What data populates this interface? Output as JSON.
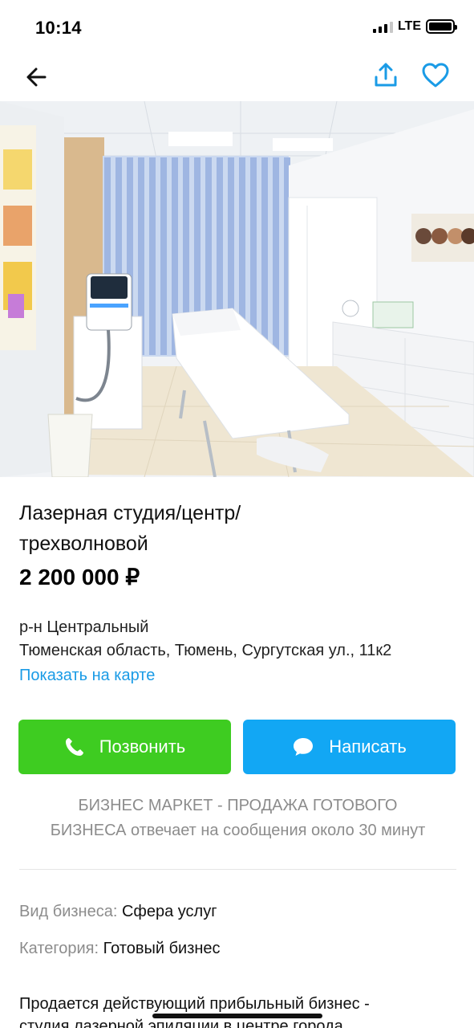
{
  "status_bar": {
    "time": "10:14",
    "network": "LTE"
  },
  "nav": {
    "back": "arrow-left-icon",
    "share": "share-icon",
    "favorite": "heart-icon"
  },
  "listing": {
    "title_line1": "Лазерная студия/центр/",
    "title_line2": "трехволновой",
    "price": "2 200 000 ₽",
    "district": "р-н Центральный",
    "address": "Тюменская область, Тюмень, Сургутская ул., 11к2",
    "map_link": "Показать на карте"
  },
  "actions": {
    "call_label": "Позвонить",
    "write_label": "Написать"
  },
  "seller": {
    "line1": "БИЗНЕС МАРКЕТ - ПРОДАЖА ГОТОВОГО",
    "line2": "БИЗНЕСА отвечает на сообщения около 30 минут"
  },
  "params": [
    {
      "key": "Вид бизнеса:",
      "value": "Сфера услуг"
    },
    {
      "key": "Категория:",
      "value": "Готовый бизнес"
    }
  ],
  "description": {
    "line1": "Продается действующий прибыльный бизнес -",
    "line2": "студия лазерной эпиляции в центре города"
  },
  "colors": {
    "call": "#3ecc21",
    "write": "#12a7f4",
    "link": "#1a9be6",
    "icon_accent": "#1a9be6"
  }
}
